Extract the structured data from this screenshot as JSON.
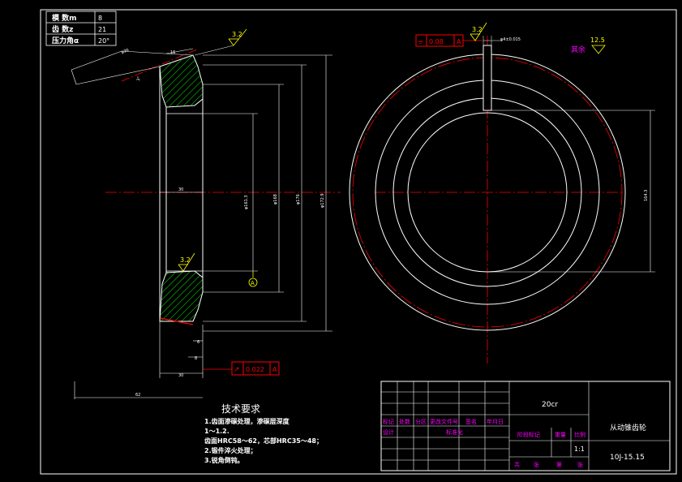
{
  "params": {
    "rows": [
      {
        "label": "模 数m",
        "value": "8"
      },
      {
        "label": "齿 数z",
        "value": "21"
      },
      {
        "label": "压力角α",
        "value": "20°"
      }
    ]
  },
  "surface_finish": {
    "top": "3.2",
    "lower": "3.2",
    "right_view": "3.2",
    "rest_value": "12.5",
    "rest_label": "其余"
  },
  "dims": {
    "slant_len": "φ36",
    "face_width": "16",
    "angle": "3°",
    "bore_dia": "φ161.3",
    "d1": "φ176",
    "d2": "φ168",
    "outer_dia": "φ172.9",
    "hub_len": "30",
    "small_8": "8",
    "small_6": "6",
    "bottom_30": "30",
    "overall": "62",
    "keyway_width": "φ4±0.015",
    "keyway_depth": "164.3"
  },
  "tolerances": {
    "symmetry": {
      "symbol": "⌯",
      "value": "0.08",
      "datum": "A"
    },
    "runout": {
      "symbol": "↗",
      "value": "0.022",
      "datum": "A"
    },
    "datum_letter": "A"
  },
  "tech_requirements": {
    "title": "技术要求",
    "lines": [
      "1.齿面渗碳处理，渗碳层深度",
      "1～1.2.",
      "齿面HRC58～62，芯部HRC35～48；",
      "2.锻件淬火处理；",
      "3.锐角倒钝。"
    ]
  },
  "title_block": {
    "material": "20cr",
    "part_name": "从动锥齿轮",
    "drawing_no": "10J-15.15",
    "scale": "1:1",
    "header_cells": [
      "标记",
      "处数",
      "分区",
      "更改文件号",
      "签名",
      "年月日"
    ],
    "sign_cells": [
      "设计",
      "标准化"
    ],
    "stage_label": "阶段标记",
    "weight_label": "重量",
    "scale_label": "比例",
    "sheet_text": [
      "共",
      "张",
      "第",
      "张"
    ]
  },
  "colors": {
    "line": "#ffffff",
    "center": "#ff0000",
    "dim": "#ffffff",
    "symbol": "#ffff00",
    "hatch": "#00ff00",
    "frame_red": "#ff0000",
    "text_magenta": "#ff00ff"
  }
}
